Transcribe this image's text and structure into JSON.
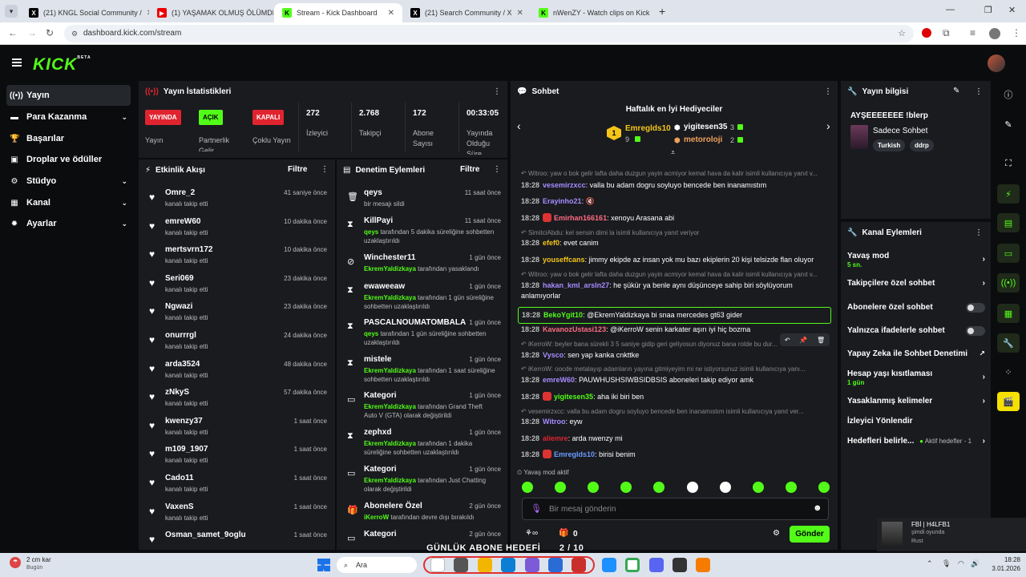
{
  "browser": {
    "tabs": [
      {
        "title": "(21) KNGL Social Community /",
        "icon": "x-icon",
        "active": false
      },
      {
        "title": "(1) YAŞAMAK OLMUŞ ÖLÜMDE",
        "icon": "youtube-icon",
        "active": false
      },
      {
        "title": "Stream - Kick Dashboard",
        "icon": "kick-icon",
        "active": true
      },
      {
        "title": "(21) Search Community / X",
        "icon": "x-icon",
        "active": false
      },
      {
        "title": "nWenZY - Watch clips on Kick",
        "icon": "kick-icon",
        "active": false
      }
    ],
    "url": "dashboard.kick.com/stream"
  },
  "header": {
    "logo": "KICK",
    "beta": "BETA"
  },
  "sidebar": {
    "items": [
      {
        "label": "Yayın",
        "icon": "stream-icon",
        "active": true,
        "chevron": false
      },
      {
        "label": "Para Kazanma",
        "icon": "money-icon",
        "active": false,
        "chevron": true
      },
      {
        "label": "Başarılar",
        "icon": "trophy-icon",
        "active": false,
        "chevron": false
      },
      {
        "label": "Droplar ve ödüller",
        "icon": "gift-icon",
        "active": false,
        "chevron": false
      },
      {
        "label": "Stüdyo",
        "icon": "studio-icon",
        "active": false,
        "chevron": true
      },
      {
        "label": "Kanal",
        "icon": "channel-icon",
        "active": false,
        "chevron": true
      },
      {
        "label": "Ayarlar",
        "icon": "settings-icon",
        "active": false,
        "chevron": true
      }
    ]
  },
  "stats": {
    "title": "Yayın İstatistikleri",
    "badges": [
      {
        "badge": "YAYINDA",
        "label": "Yayın",
        "color": "#e0242f"
      },
      {
        "badge": "AÇIK",
        "label": "Partnerlik Gelir Paylaşımı",
        "color": "#53fc18"
      },
      {
        "badge": "KAPALI",
        "label": "Çoklu Yayın",
        "color": "#e0242f"
      }
    ],
    "numbers": [
      {
        "value": "272",
        "label": "İzleyici"
      },
      {
        "value": "2.768",
        "label": "Takipçi"
      },
      {
        "value": "172",
        "label": "Abone Sayısı"
      },
      {
        "value": "00:33:05",
        "label": "Yayında Olduğu Süre"
      }
    ]
  },
  "activity": {
    "title": "Etkinlik Akışı",
    "filter": "Filtre",
    "items": [
      {
        "user": "Omre_2",
        "action": "kanalı takip etti",
        "time": "41 saniye önce"
      },
      {
        "user": "emreW60",
        "action": "kanalı takip etti",
        "time": "10 dakika önce"
      },
      {
        "user": "mertsvrn172",
        "action": "kanalı takip etti",
        "time": "10 dakika önce"
      },
      {
        "user": "Seri069",
        "action": "kanalı takip etti",
        "time": "23 dakika önce"
      },
      {
        "user": "Ngwazi",
        "action": "kanalı takip etti",
        "time": "23 dakika önce"
      },
      {
        "user": "onurrrgl",
        "action": "kanalı takip etti",
        "time": "24 dakika önce"
      },
      {
        "user": "arda3524",
        "action": "kanalı takip etti",
        "time": "48 dakika önce"
      },
      {
        "user": "zNkyS",
        "action": "kanalı takip etti",
        "time": "57 dakika önce"
      },
      {
        "user": "kwenzy37",
        "action": "kanalı takip etti",
        "time": "1 saat önce"
      },
      {
        "user": "m109_1907",
        "action": "kanalı takip etti",
        "time": "1 saat önce"
      },
      {
        "user": "Cado11",
        "action": "kanalı takip etti",
        "time": "1 saat önce"
      },
      {
        "user": "VaxenS",
        "action": "kanalı takip etti",
        "time": "1 saat önce"
      },
      {
        "user": "Osman_samet_9oglu",
        "action": "",
        "time": "1 saat önce"
      }
    ]
  },
  "moderation": {
    "title": "Denetim Eylemleri",
    "filter": "Filtre",
    "items": [
      {
        "name": "qeys",
        "icon": "trash-icon",
        "time": "11 saat önce",
        "actor": "",
        "desc": "bir mesajı sildi"
      },
      {
        "name": "KillPayi",
        "icon": "hourglass-icon",
        "time": "11 saat önce",
        "actor": "qeys",
        "desc": " tarafından 5 dakika süreliğine sohbetten uzaklaştırıldı"
      },
      {
        "name": "Winchester11",
        "icon": "ban-icon",
        "time": "1 gün önce",
        "actor": "EkremYaldizkaya",
        "desc": " tarafından yasaklandı"
      },
      {
        "name": "ewaweeaw",
        "icon": "hourglass-icon",
        "time": "1 gün önce",
        "actor": "EkremYaldizkaya",
        "desc": " tarafından 1 gün süreliğine sohbetten uzaklaştırıldı"
      },
      {
        "name": "PASCALNOUMATOMBALA",
        "icon": "hourglass-icon",
        "time": "1 gün önce",
        "actor": "qeys",
        "desc": " tarafından 1 gün süreliğine sohbetten uzaklaştırıldı"
      },
      {
        "name": "mistele",
        "icon": "hourglass-icon",
        "time": "1 gün önce",
        "actor": "EkremYaldizkaya",
        "desc": " tarafından 1 saat süreliğine sohbetten uzaklaştırıldı"
      },
      {
        "name": "Kategori",
        "icon": "category-icon",
        "time": "1 gün önce",
        "actor": "EkremYaldizkaya",
        "desc": " tarafından Grand Theft Auto V (GTA) olarak değiştirildi"
      },
      {
        "name": "zephxd",
        "icon": "hourglass-icon",
        "time": "1 gün önce",
        "actor": "EkremYaldizkaya",
        "desc": " tarafından 1 dakika süreliğine sohbetten uzaklaştırıldı"
      },
      {
        "name": "Kategori",
        "icon": "category-icon",
        "time": "1 gün önce",
        "actor": "EkremYaldizkaya",
        "desc": " tarafından Just Chatting olarak değiştirildi"
      },
      {
        "name": "Abonelere Özel",
        "icon": "gift-icon",
        "time": "2 gün önce",
        "actor": "iKerroW",
        "desc": " tarafından devre dışı bırakıldı"
      },
      {
        "name": "Kategori",
        "icon": "category-icon",
        "time": "2 gün önce",
        "actor": "",
        "desc": ""
      }
    ]
  },
  "chat": {
    "title": "Sohbet",
    "leaderboard_title": "Haftalık en İyi Hediyeciler",
    "top_gifters": [
      {
        "name": "Emreglds10",
        "count": "9",
        "rank": "1",
        "color": "#f5c518"
      },
      {
        "name": "yigitesen35",
        "count": "3",
        "rank": "",
        "color": "#ffffff"
      },
      {
        "name": "metoroloji",
        "count": "2",
        "rank": "",
        "color": "#f0a05a"
      }
    ],
    "messages": [
      {
        "type": "reply",
        "text": "Witroo: yaw o bok gelir lafta daha duzgun yayin acmiyor kemal hava da kalir isimli kullanıcıya yanıt v..."
      },
      {
        "type": "msg",
        "time": "18:28",
        "user": "vesemirzxcc",
        "color": "#a88bff",
        "text": "valla bu adam dogru soyluyo bencede ben inanamıstım",
        "emote": false
      },
      {
        "type": "msg",
        "time": "18:28",
        "user": "Erayinho21",
        "color": "#a88bff",
        "text": "🔇",
        "emote": false
      },
      {
        "type": "msg",
        "time": "18:28",
        "user": "Emirhan166161",
        "color": "#ff6b81",
        "text": "xenoyu Arasana abi",
        "emote": true
      },
      {
        "type": "reply",
        "text": "SimitciAbdu: kel sensin dimi la isimli kullanıcıya yanıt veriyor"
      },
      {
        "type": "msg",
        "time": "18:28",
        "user": "efef0",
        "color": "#f5c518",
        "text": "evet canim",
        "emote": false
      },
      {
        "type": "msg",
        "time": "18:28",
        "user": "youseffcans",
        "color": "#f5c518",
        "text": "jimmy ekipde az insan yok mu bazı ekiplerin 20 kişi telsizde flan oluyor",
        "emote": false
      },
      {
        "type": "reply",
        "text": "Witroo: yaw o bok gelir lafta daha duzgun yayin acmiyor kemal hava da kalir isimli kullanıcıya yanıt v..."
      },
      {
        "type": "msg",
        "time": "18:28",
        "user": "hakan_kml_arsln27",
        "color": "#a88bff",
        "text": "he şükür ya benle aynı düşünceye sahip biri söylüyorum",
        "emote": false
      },
      {
        "type": "cont",
        "text": "anlamıyorlar"
      },
      {
        "type": "highlight",
        "time": "18:28",
        "user": "BekoYgit10",
        "color": "#53fc18",
        "text": "@EkremYaldizkaya bi snaa mercedes gt63 gider"
      },
      {
        "type": "msg",
        "time": "18:28",
        "user": "KavanozUstasi123",
        "color": "#ff6b81",
        "text": "@iKerroW senin karkater aşırı iyi hiç bozma",
        "emote": false
      },
      {
        "type": "reply",
        "text": "iKerroW: beyler bana sürekli 3 5 saniye gidip geri geliyosun diyonuz bana rolde bu dur..."
      },
      {
        "type": "msg",
        "time": "18:28",
        "user": "Vysco",
        "color": "#a88bff",
        "text": "sen yap kanka cnkttke",
        "emote": false
      },
      {
        "type": "reply",
        "text": "iKerroW: oocde metalayıp adamların yayına gitmiyeyim mi ne istiyorsunuz isimli kullanıcıya yanı..."
      },
      {
        "type": "msg",
        "time": "18:28",
        "user": "emreW60",
        "color": "#a88bff",
        "text": "PAUWHUSHSIWBSIDBSIS aboneleri takip ediyor amk",
        "emote": false
      },
      {
        "type": "msg",
        "time": "18:28",
        "user": "yigitesen35",
        "color": "#53fc18",
        "text": "aha iki biri ben",
        "emote": true
      },
      {
        "type": "reply",
        "text": "vesemirzxcc: valla bu adam dogru soyluyo bencede ben inanamıstım isimli kullanıcıya yanıt ver..."
      },
      {
        "type": "msg",
        "time": "18:28",
        "user": "Witroo",
        "color": "#a88bff",
        "text": "eyw",
        "emote": false
      },
      {
        "type": "msg",
        "time": "18:28",
        "user": "aliemre",
        "color": "#e0242f",
        "text": "arda nwenzy mi",
        "emote": false
      },
      {
        "type": "msg",
        "time": "18:28",
        "user": "Emreglds10",
        "color": "#6a9cff",
        "text": "birisi benim",
        "emote": true
      }
    ],
    "slow_mode": "Yavaş mod aktif",
    "input_placeholder": "Bir mesaj gönderin",
    "points": "0",
    "send_label": "Gönder"
  },
  "stream_info": {
    "title": "Yayın bilgisi",
    "stream_title": "AYŞEEEEEEE !blerp",
    "category": "Sadece Sohbet",
    "tags": [
      "Turkish",
      "ddrp"
    ]
  },
  "channel_actions": {
    "title": "Kanal Eylemleri",
    "items": [
      {
        "label": "Yavaş mod",
        "sub": "5 sn.",
        "control": "chevron"
      },
      {
        "label": "Takipçilere özel sohbet",
        "sub": "",
        "control": "chevron"
      },
      {
        "label": "Abonelere özel sohbet",
        "sub": "",
        "control": "toggle"
      },
      {
        "label": "Yalnızca ifadelerle sohbet",
        "sub": "",
        "control": "toggle"
      },
      {
        "label": "Yapay Zeka ile Sohbet Denetimi",
        "sub": "",
        "control": "external"
      },
      {
        "label": "Hesap yaşı kısıtlaması",
        "sub": "1 gün",
        "control": "chevron"
      },
      {
        "label": "Yasaklanmış kelimeler",
        "sub": "",
        "control": "chevron"
      },
      {
        "label": "İzleyici Yönlendir",
        "sub": "",
        "control": "none"
      },
      {
        "label": "Hedefleri belirle...",
        "sub": "Aktif hedefler - 1",
        "control": "chevron"
      }
    ]
  },
  "overlay": {
    "goal_text": "GÜNLÜK ABONE HEDEFİ",
    "goal_progress": "2 / 10",
    "notif_name": "FBİ | H4LFB1",
    "notif_status": "şimdi oyunda",
    "notif_game": "Rust"
  },
  "taskbar": {
    "weather": "2 cm kar",
    "weather_sub": "Bugün",
    "search": "Ara",
    "time": "18:28",
    "date": "3.01.2026"
  },
  "colors": {
    "accent": "#53fc18",
    "live": "#e0242f",
    "panel": "#191b1f"
  }
}
